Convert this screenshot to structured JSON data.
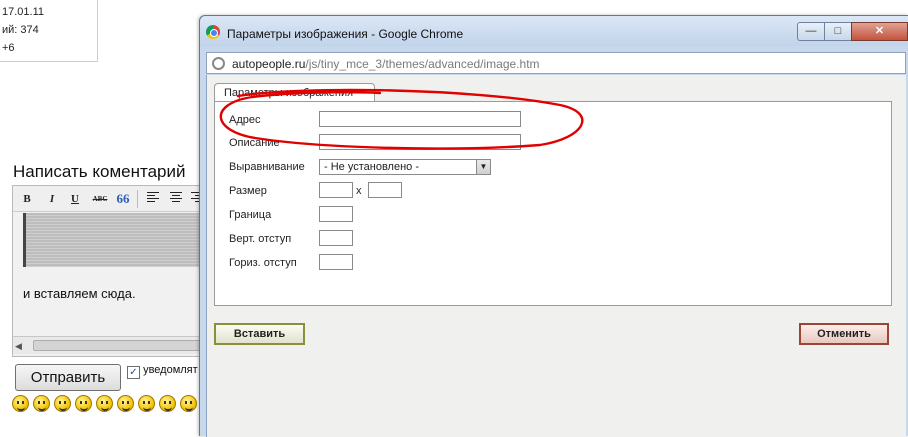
{
  "background": {
    "info_lines": [
      "17.01.11",
      "ий: 374",
      "+6"
    ],
    "comment_title": "Написать коментарий",
    "editor_text": "и вставляем сюда.",
    "submit_label": "Отправить",
    "notify_label": "уведомлят",
    "toolbar": [
      "B",
      "I",
      "U",
      "ABC",
      "66"
    ]
  },
  "window": {
    "title": "Параметры изображения - Google Chrome",
    "url_domain": "autopeople.ru",
    "url_path": "/js/tiny_mce_3/themes/advanced/image.htm",
    "controls": {
      "minimize": "—",
      "maximize": "□",
      "close": "✕"
    }
  },
  "dialog": {
    "tab_label": "Параметры изображения",
    "fields": {
      "address": {
        "label": "Адрес",
        "value": ""
      },
      "description": {
        "label": "Описание",
        "value": ""
      },
      "align": {
        "label": "Выравнивание",
        "value": "- Не установлено -"
      },
      "size": {
        "label": "Размер",
        "width": "",
        "height": "",
        "sep": "x"
      },
      "border": {
        "label": "Граница",
        "value": ""
      },
      "vspace": {
        "label": "Верт. отступ",
        "value": ""
      },
      "hspace": {
        "label": "Гориз. отступ",
        "value": ""
      }
    },
    "insert_label": "Вставить",
    "cancel_label": "Отменить"
  },
  "annotation_color": "#e00000"
}
